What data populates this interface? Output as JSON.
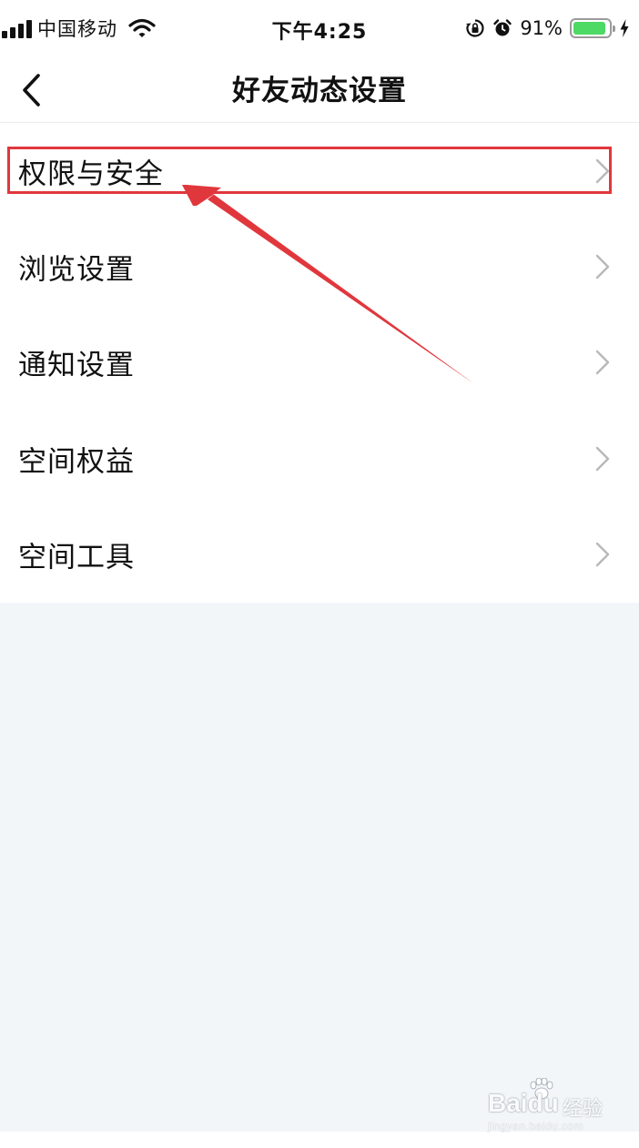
{
  "status_bar": {
    "carrier": "中国移动",
    "time": "下午4:25",
    "battery_percent": "91%",
    "battery_level": 0.91,
    "icons": [
      "signal-icon",
      "wifi-icon",
      "orientation-lock-icon",
      "alarm-icon",
      "battery-icon",
      "charging-icon"
    ]
  },
  "nav": {
    "title": "好友动态设置",
    "back_icon": "chevron-left-icon"
  },
  "menu": {
    "items": [
      {
        "label": "权限与安全"
      },
      {
        "label": "浏览设置"
      },
      {
        "label": "通知设置"
      },
      {
        "label": "空间权益"
      },
      {
        "label": "空间工具"
      }
    ],
    "chevron_icon": "chevron-right-icon"
  },
  "annotation": {
    "highlighted_item": "权限与安全",
    "color": "#e0373d"
  },
  "watermark": {
    "brand": "Bai",
    "brand_suffix": "du",
    "product": "经验",
    "url": "jingyan.baidu.com"
  },
  "colors": {
    "background": "#f3f6f9",
    "surface": "#ffffff",
    "text": "#111111",
    "chevron": "#b8b8b8",
    "battery_fill": "#4cd964"
  }
}
